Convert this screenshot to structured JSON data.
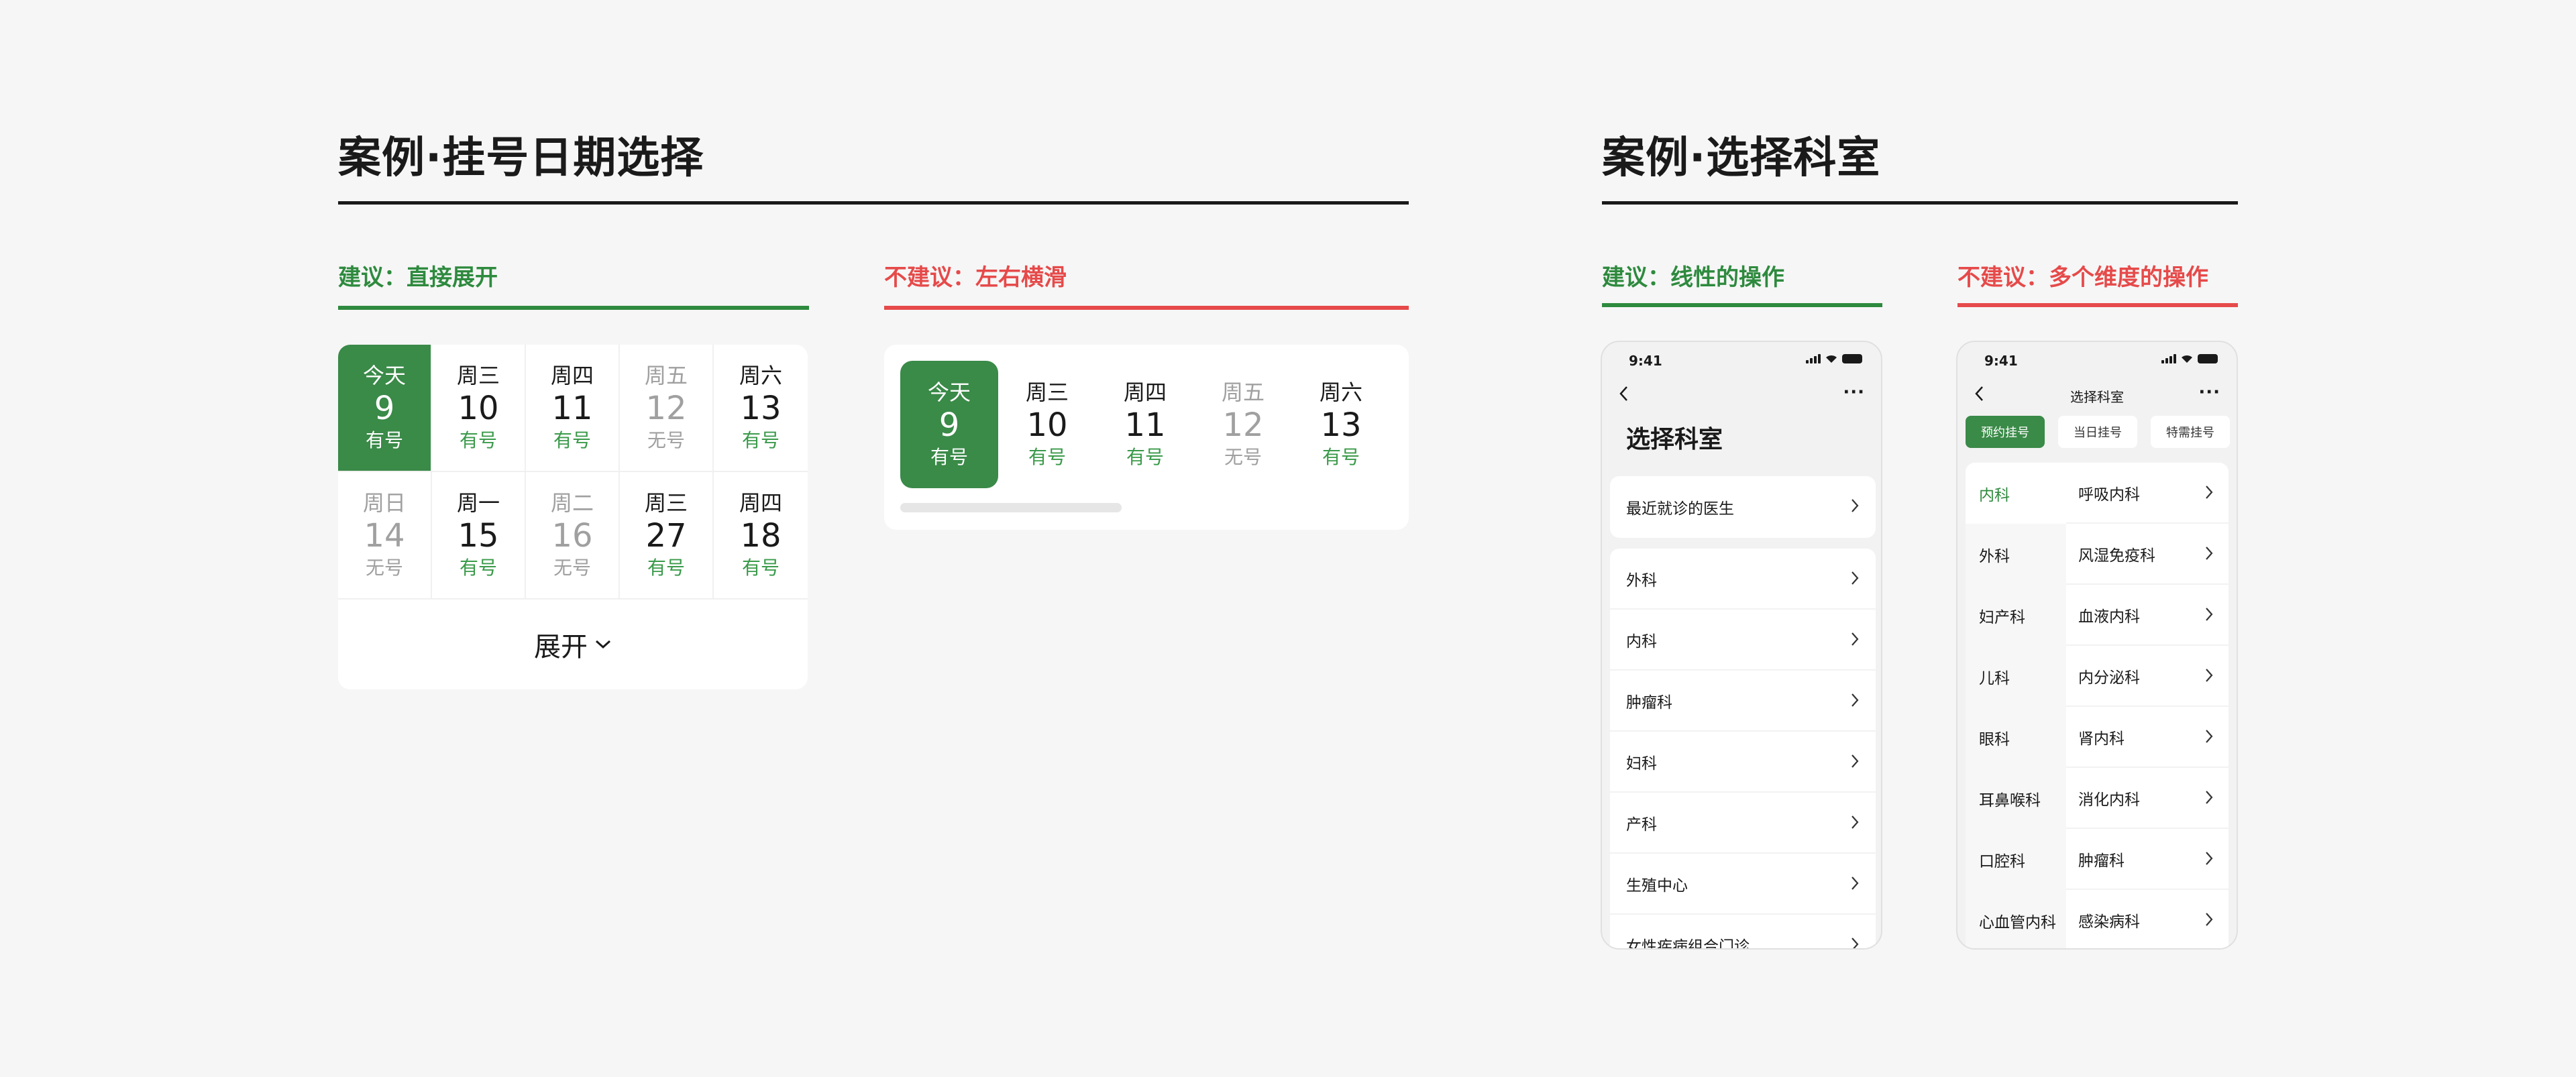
{
  "left_section": {
    "title": "案例·挂号日期选择",
    "recommended_label": "建议：直接展开",
    "not_recommended_label": "不建议：左右横滑",
    "grid_rows": [
      [
        {
          "weekday": "今天",
          "date": "9",
          "status": "有号",
          "state": "selected"
        },
        {
          "weekday": "周三",
          "date": "10",
          "status": "有号",
          "state": "available"
        },
        {
          "weekday": "周四",
          "date": "11",
          "status": "有号",
          "state": "available"
        },
        {
          "weekday": "周五",
          "date": "12",
          "status": "无号",
          "state": "unavailable"
        },
        {
          "weekday": "周六",
          "date": "13",
          "status": "有号",
          "state": "available"
        }
      ],
      [
        {
          "weekday": "周日",
          "date": "14",
          "status": "无号",
          "state": "unavailable"
        },
        {
          "weekday": "周一",
          "date": "15",
          "status": "有号",
          "state": "available"
        },
        {
          "weekday": "周二",
          "date": "16",
          "status": "无号",
          "state": "unavailable"
        },
        {
          "weekday": "周三",
          "date": "27",
          "status": "有号",
          "state": "available"
        },
        {
          "weekday": "周四",
          "date": "18",
          "status": "有号",
          "state": "available"
        }
      ]
    ],
    "expand_label": "展开",
    "horizontal_days": [
      {
        "weekday": "今天",
        "date": "9",
        "status": "有号",
        "state": "selected"
      },
      {
        "weekday": "周三",
        "date": "10",
        "status": "有号",
        "state": "available"
      },
      {
        "weekday": "周四",
        "date": "11",
        "status": "有号",
        "state": "available"
      },
      {
        "weekday": "周五",
        "date": "12",
        "status": "无号",
        "state": "unavailable"
      },
      {
        "weekday": "周六",
        "date": "13",
        "status": "有号",
        "state": "available"
      }
    ]
  },
  "right_section": {
    "title": "案例·选择科室",
    "recommended_label": "建议：线性的操作",
    "not_recommended_label": "不建议：多个维度的操作",
    "phone1": {
      "time": "9:41",
      "page_title": "选择科室",
      "recent_item": "最近就诊的医生",
      "departments": [
        "外科",
        "内科",
        "肿瘤科",
        "妇科",
        "产科",
        "生殖中心",
        "女性疾病组合门诊"
      ]
    },
    "phone2": {
      "time": "9:41",
      "nav_title": "选择科室",
      "tabs": [
        "预约挂号",
        "当日挂号",
        "特需挂号"
      ],
      "active_tab": 0,
      "left_categories": [
        "内科",
        "外科",
        "妇产科",
        "儿科",
        "眼科",
        "耳鼻喉科",
        "口腔科",
        "心血管内科"
      ],
      "active_category": 0,
      "sub_departments": [
        "呼吸内科",
        "风湿免疫科",
        "血液内科",
        "内分泌科",
        "肾内科",
        "消化内科",
        "肿瘤科",
        "感染病科"
      ]
    }
  },
  "colors": {
    "green": "#2e8a3e",
    "selected_green": "#3a8a48",
    "red": "#e64a4a",
    "background": "#f6f6f6"
  }
}
